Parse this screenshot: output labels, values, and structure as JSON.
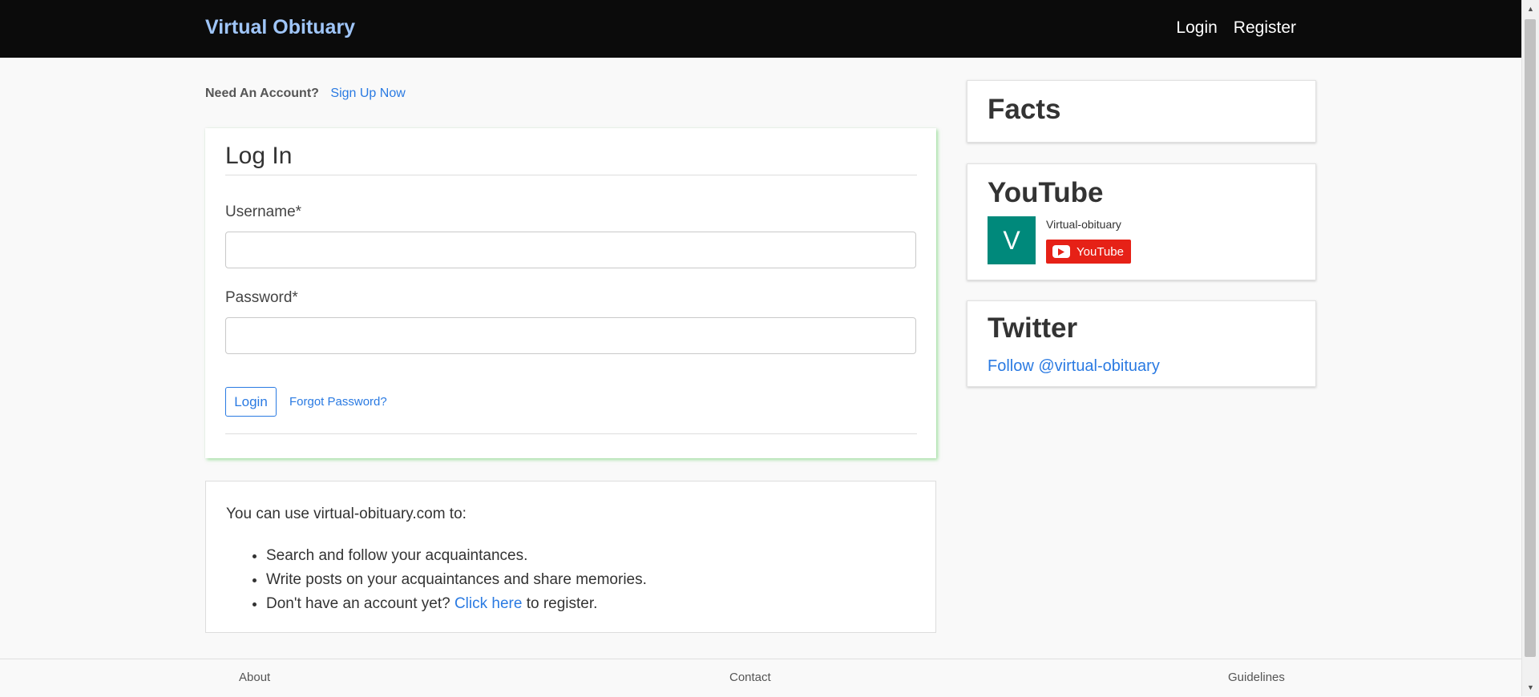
{
  "navbar": {
    "brand": "Virtual Obituary",
    "links": [
      "Login",
      "Register"
    ]
  },
  "account_prompt": {
    "label": "Need An Account?",
    "link": "Sign Up Now"
  },
  "login_form": {
    "title": "Log In",
    "username_label": "Username*",
    "username_value": "",
    "password_label": "Password*",
    "password_value": "",
    "submit_label": "Login",
    "forgot_link": "Forgot Password?"
  },
  "info": {
    "intro": "You can use virtual-obituary.com to:",
    "items": [
      "Search and follow your acquaintances.",
      "Write posts on your acquaintances and share memories."
    ],
    "register_prefix": "Don't have an account yet?",
    "register_link": "Click here",
    "register_suffix": "to register."
  },
  "sidebar": {
    "facts_title": "Facts",
    "youtube": {
      "title": "YouTube",
      "avatar_letter": "V",
      "channel_name": "Virtual-obituary",
      "subscribe_label": "YouTube",
      "avatar_color": "#00897b",
      "button_color": "#e62117"
    },
    "twitter": {
      "title": "Twitter",
      "follow_link": "Follow @virtual-obituary"
    }
  },
  "footer": {
    "links": [
      "About",
      "Contact",
      "Guidelines"
    ]
  },
  "colors": {
    "navbar_bg": "#0b0b0b",
    "brand": "#9fc5f8",
    "link": "#2a7ae2",
    "page_bg": "#f9f9f9"
  }
}
